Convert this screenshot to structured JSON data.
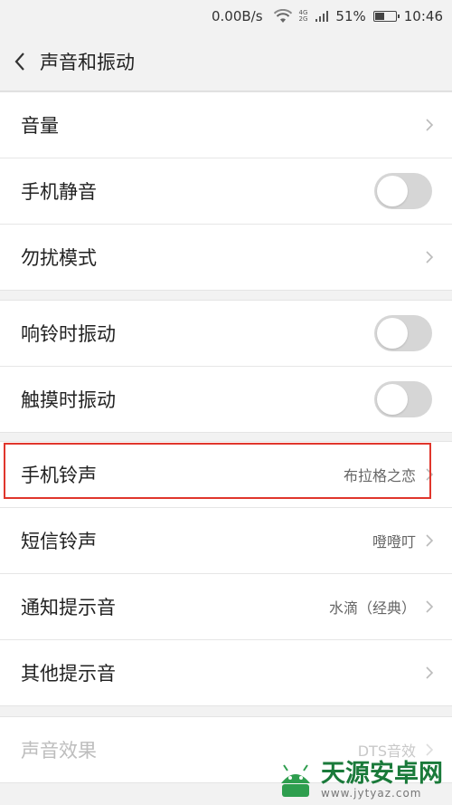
{
  "status_bar": {
    "net_speed": "0.00B/s",
    "net_type_top": "4G",
    "net_type_bottom": "2G",
    "battery_percent": "51%",
    "battery_level": 0.51,
    "time": "10:46"
  },
  "header": {
    "title": "声音和振动",
    "back_icon": "chevron-left-icon"
  },
  "group1": [
    {
      "label": "音量",
      "control": "chevron"
    },
    {
      "label": "手机静音",
      "control": "toggle",
      "on": false
    },
    {
      "label": "勿扰模式",
      "control": "chevron"
    }
  ],
  "group2": [
    {
      "label": "响铃时振动",
      "control": "toggle",
      "on": false
    },
    {
      "label": "触摸时振动",
      "control": "toggle",
      "on": false
    }
  ],
  "group3": [
    {
      "label": "手机铃声",
      "value": "布拉格之恋",
      "control": "chevron"
    },
    {
      "label": "短信铃声",
      "value": "噔噔叮",
      "control": "chevron"
    },
    {
      "label": "通知提示音",
      "value": "水滴（经典）",
      "control": "chevron"
    },
    {
      "label": "其他提示音",
      "control": "chevron"
    }
  ],
  "group4": [
    {
      "label": "声音效果",
      "value": "DTS音效",
      "control": "chevron",
      "disabled": true
    }
  ],
  "watermark": {
    "name": "天源安卓网",
    "url": "www.jytyaz.com"
  },
  "colors": {
    "highlight": "#e0362c",
    "toggle_off": "#d6d6d6",
    "watermark_green": "#1a7a3a"
  }
}
